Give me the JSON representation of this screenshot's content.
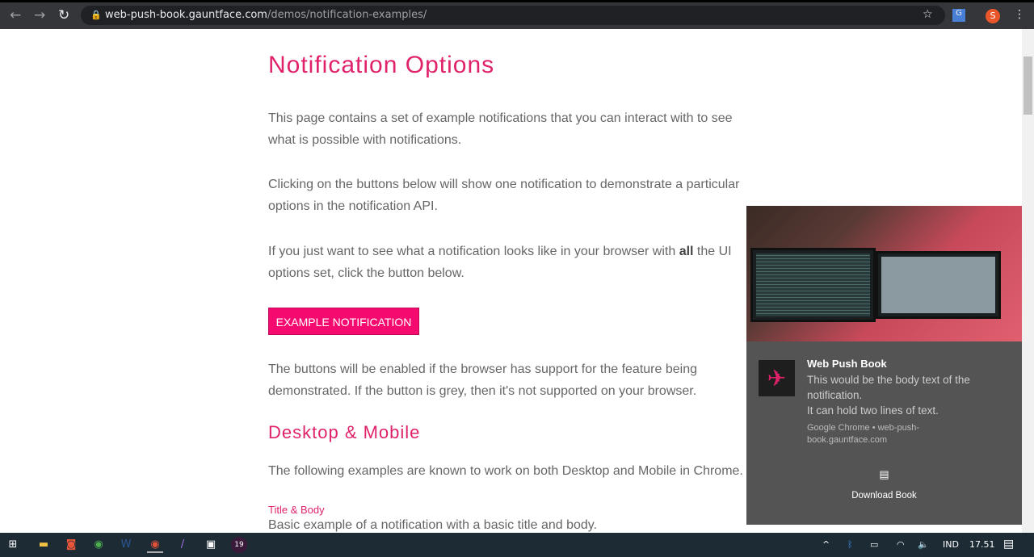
{
  "browser": {
    "url_host": "web-push-book.gauntface.com",
    "url_path": "/demos/notification-examples/",
    "profile_initial": "S",
    "icons": [
      "back-icon",
      "forward-icon",
      "reload-icon",
      "lock-icon",
      "star-icon",
      "translate-icon",
      "menu-icon"
    ]
  },
  "page": {
    "title": "Notification Options",
    "para1": "This page contains a set of example notifications that you can interact with to see what is possible with notifications.",
    "para2": "Clicking on the buttons below will show one notification to demonstrate a particular options in the notification API.",
    "para3_pre": "If you just want to see what a notification looks like in your browser with ",
    "para3_bold": "all",
    "para3_post": " the UI options set, click the button below.",
    "example_button": "EXAMPLE NOTIFICATION",
    "para4": "The buttons will be enabled if the browser has support for the feature being demonstrated. If the button is grey, then it's not supported on your browser.",
    "section_title": "Desktop & Mobile",
    "section_desc": "The following examples are known to work on both Desktop and Mobile in Chrome.",
    "sub_title": "Title & Body",
    "sub_desc": "Basic example of a notification with a basic title and body.",
    "accent": "#e0226b"
  },
  "notification": {
    "title": "Web Push Book",
    "body1": "This would be the body text of the notification.",
    "body2": "It can hold two lines of text.",
    "source": "Google Chrome • web-push-book.gauntface.com",
    "action": "Download Book"
  },
  "taskbar": {
    "badge": "19",
    "language": "IND",
    "time": "17.51"
  }
}
